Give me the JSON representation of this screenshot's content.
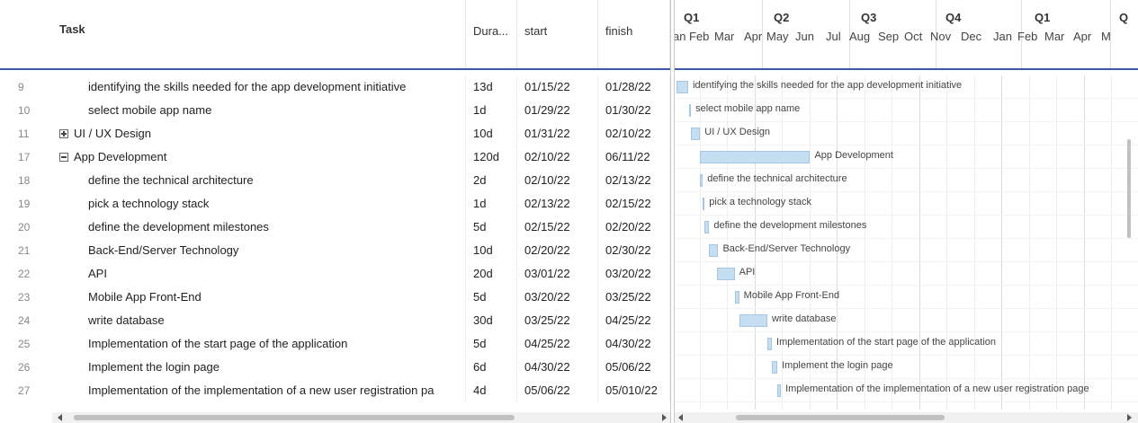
{
  "grid": {
    "headers": {
      "task": "Task",
      "duration": "Dura...",
      "start": "start",
      "finish": "finish"
    },
    "rows": [
      {
        "num": "9",
        "task": "identifying the skills needed for the app development initiative",
        "duration": "13d",
        "start": "01/15/22",
        "finish": "01/28/22",
        "level": 2,
        "toggle": ""
      },
      {
        "num": "10",
        "task": "select mobile app name",
        "duration": "1d",
        "start": "01/29/22",
        "finish": "01/30/22",
        "level": 2,
        "toggle": ""
      },
      {
        "num": "11",
        "task": "UI / UX Design",
        "duration": "10d",
        "start": "01/31/22",
        "finish": "02/10/22",
        "level": 1,
        "toggle": "plus"
      },
      {
        "num": "17",
        "task": "App Development",
        "duration": "120d",
        "start": "02/10/22",
        "finish": "06/11/22",
        "level": 1,
        "toggle": "minus"
      },
      {
        "num": "18",
        "task": "define the technical architecture",
        "duration": "2d",
        "start": "02/10/22",
        "finish": "02/13/22",
        "level": 2,
        "toggle": ""
      },
      {
        "num": "19",
        "task": "pick a technology stack",
        "duration": "1d",
        "start": "02/13/22",
        "finish": "02/15/22",
        "level": 2,
        "toggle": ""
      },
      {
        "num": "20",
        "task": "define the development milestones",
        "duration": "5d",
        "start": "02/15/22",
        "finish": "02/20/22",
        "level": 2,
        "toggle": ""
      },
      {
        "num": "21",
        "task": "Back-End/Server Technology",
        "duration": "10d",
        "start": "02/20/22",
        "finish": "02/30/22",
        "level": 2,
        "toggle": ""
      },
      {
        "num": "22",
        "task": "API",
        "duration": "20d",
        "start": "03/01/22",
        "finish": "03/20/22",
        "level": 2,
        "toggle": ""
      },
      {
        "num": "23",
        "task": "Mobile App Front-End",
        "duration": "5d",
        "start": "03/20/22",
        "finish": "03/25/22",
        "level": 2,
        "toggle": ""
      },
      {
        "num": "24",
        "task": "write database",
        "duration": "30d",
        "start": "03/25/22",
        "finish": "04/25/22",
        "level": 2,
        "toggle": ""
      },
      {
        "num": "25",
        "task": "Implementation of the start page of the application",
        "duration": "5d",
        "start": "04/25/22",
        "finish": "04/30/22",
        "level": 2,
        "toggle": ""
      },
      {
        "num": "26",
        "task": "Implement the login page",
        "duration": "6d",
        "start": "04/30/22",
        "finish": "05/06/22",
        "level": 2,
        "toggle": ""
      },
      {
        "num": "27",
        "task": "Implementation of the implementation of a new user registration pa",
        "duration": "4d",
        "start": "05/06/22",
        "finish": "05/010/22",
        "level": 2,
        "toggle": ""
      }
    ]
  },
  "timeline": {
    "quarters": [
      "Q1",
      "Q2",
      "Q3",
      "Q4",
      "Q1",
      "Q"
    ],
    "months": [
      "an",
      "Feb",
      "Mar",
      "Apr",
      "May",
      "Jun",
      "Jul",
      "Aug",
      "Sep",
      "Oct",
      "Nov",
      "Dec",
      "Jan",
      "Feb",
      "Mar",
      "Apr",
      "M"
    ],
    "tasks": [
      {
        "label": "identifying the skills needed for the app development initiative",
        "start": "01/15/22",
        "finish": "01/28/22"
      },
      {
        "label": "select mobile app name",
        "start": "01/29/22",
        "finish": "01/30/22"
      },
      {
        "label": "UI / UX Design",
        "start": "01/31/22",
        "finish": "02/10/22"
      },
      {
        "label": "App Development",
        "start": "02/10/22",
        "finish": "06/11/22"
      },
      {
        "label": "define the technical architecture",
        "start": "02/10/22",
        "finish": "02/13/22"
      },
      {
        "label": "pick a technology stack",
        "start": "02/13/22",
        "finish": "02/15/22"
      },
      {
        "label": "define the development milestones",
        "start": "02/15/22",
        "finish": "02/20/22"
      },
      {
        "label": "Back-End/Server Technology",
        "start": "02/20/22",
        "finish": "03/02/22"
      },
      {
        "label": "API",
        "start": "03/01/22",
        "finish": "03/20/22"
      },
      {
        "label": "Mobile App Front-End",
        "start": "03/20/22",
        "finish": "03/25/22"
      },
      {
        "label": "write database",
        "start": "03/25/22",
        "finish": "04/25/22"
      },
      {
        "label": "Implementation of the start page of the application",
        "start": "04/25/22",
        "finish": "04/30/22"
      },
      {
        "label": "Implement the login page",
        "start": "04/30/22",
        "finish": "05/06/22"
      },
      {
        "label": "Implementation of the implementation of a new user registration page",
        "start": "05/06/22",
        "finish": "05/10/22"
      }
    ]
  },
  "colors": {
    "bar_fill": "#c6def1",
    "bar_border": "#a7c6e2",
    "header_rule": "#3c5aa6"
  }
}
